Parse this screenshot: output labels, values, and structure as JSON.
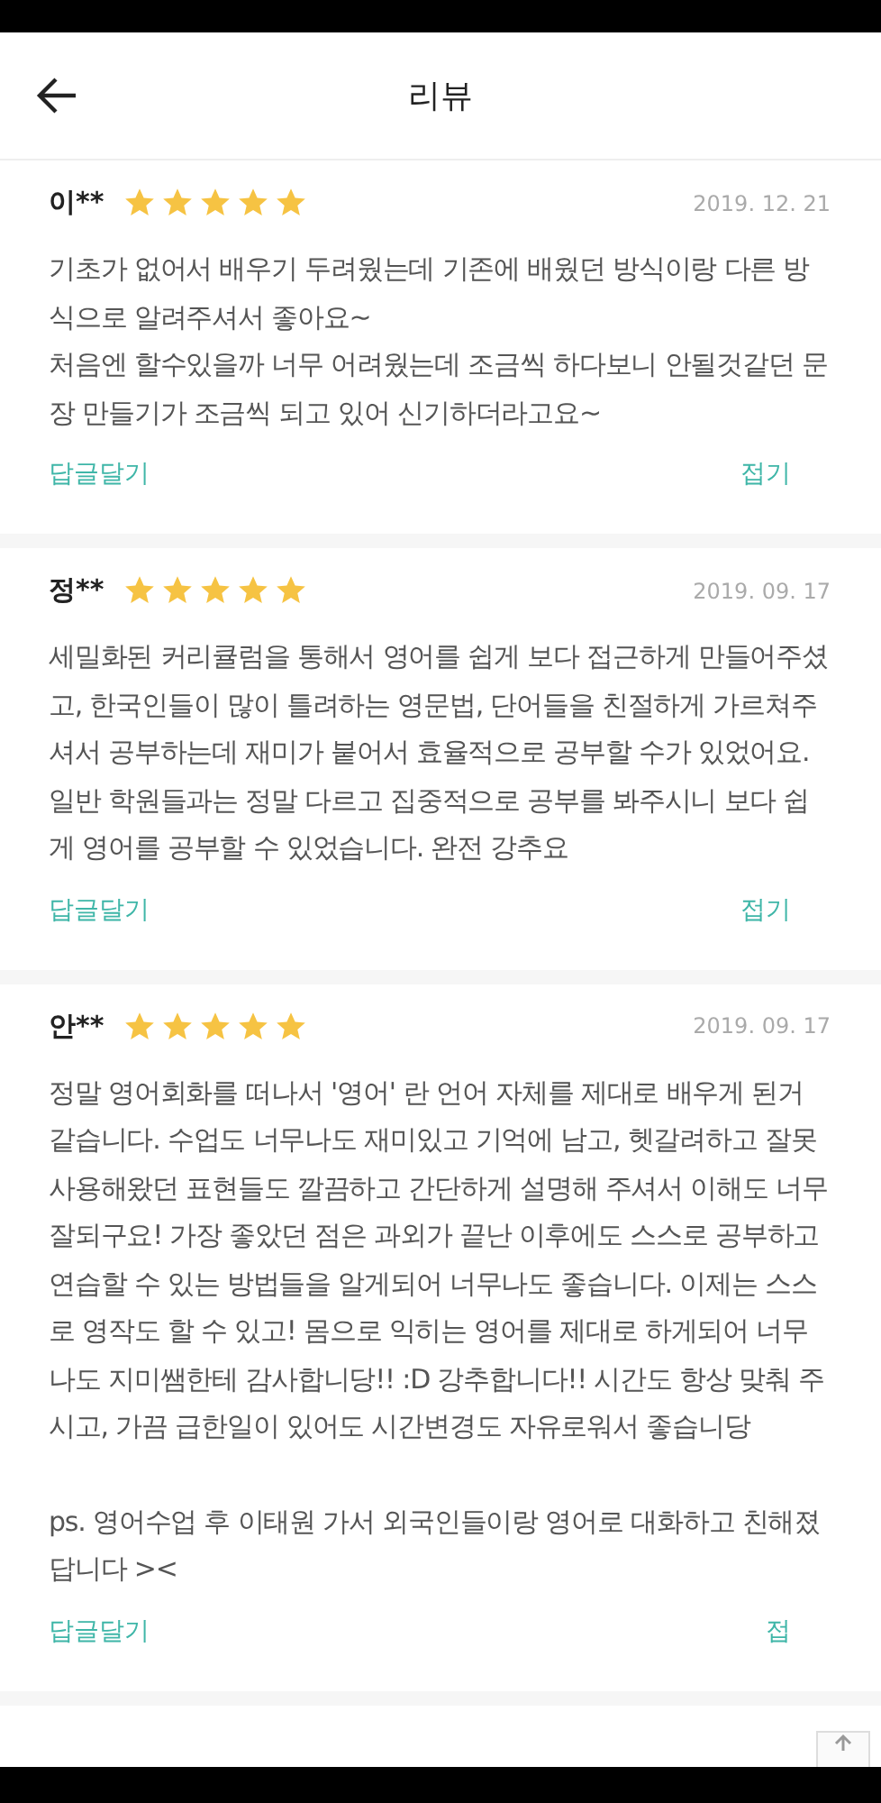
{
  "header": {
    "title": "리뷰"
  },
  "reviews": [
    {
      "name": "이**",
      "stars": 5,
      "date": "2019. 12. 21",
      "paragraphs": [
        "기초가 없어서 배우기 두려웠는데 기존에 배웠던 방식이랑 다른 방식으로 알려주셔서 좋아요~",
        "처음엔 할수있을까 너무 어려웠는데 조금씩 하다보니 안될것같던 문장 만들기가 조금씩 되고 있어 신기하더라고요~"
      ],
      "reply": "답글달기",
      "fold": "접기"
    },
    {
      "name": "정**",
      "stars": 5,
      "date": "2019. 09. 17",
      "paragraphs": [
        "세밀화된 커리큘럼을 통해서 영어를 쉽게 보다 접근하게 만들어주셨고,  한국인들이 많이 틀려하는 영문법, 단어들을 친절하게 가르쳐주셔서 공부하는데 재미가 붙어서 효율적으로 공부할 수가 있었어요. 일반 학원들과는 정말 다르고 집중적으로 공부를 봐주시니 보다 쉽게 영어를 공부할 수 있었습니다. 완전 강추요"
      ],
      "reply": "답글달기",
      "fold": "접기"
    },
    {
      "name": "안**",
      "stars": 5,
      "date": "2019. 09. 17",
      "paragraphs": [
        "정말 영어회화를 떠나서 '영어' 란 언어 자체를 제대로 배우게 된거 같습니다. 수업도 너무나도 재미있고 기억에 남고, 헷갈려하고 잘못 사용해왔던 표현들도 깔끔하고 간단하게 설명해 주셔서 이해도 너무 잘되구요! 가장 좋았던 점은 과외가 끝난 이후에도 스스로 공부하고 연습할 수 있는 방법들을 알게되어 너무나도 좋습니다. 이제는 스스로 영작도 할 수 있고! 몸으로 익히는 영어를 제대로 하게되어 너무나도 지미쌤한테 감사합니당!! :D 강추합니다!! 시간도 항상 맞춰 주시고, 가끔 급한일이 있어도 시간변경도 자유로워서 좋습니당",
        "ps. 영어수업 후 이태원 가서 외국인들이랑 영어로 대화하고 친해졌답니다 ><"
      ],
      "reply": "답글달기",
      "fold": "접"
    }
  ]
}
